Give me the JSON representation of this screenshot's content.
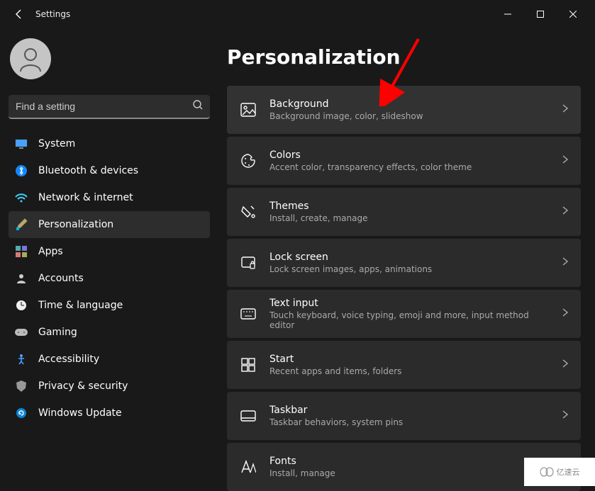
{
  "app_title": "Settings",
  "search": {
    "placeholder": "Find a setting"
  },
  "sidebar": {
    "items": [
      {
        "label": "System"
      },
      {
        "label": "Bluetooth & devices"
      },
      {
        "label": "Network & internet"
      },
      {
        "label": "Personalization"
      },
      {
        "label": "Apps"
      },
      {
        "label": "Accounts"
      },
      {
        "label": "Time & language"
      },
      {
        "label": "Gaming"
      },
      {
        "label": "Accessibility"
      },
      {
        "label": "Privacy & security"
      },
      {
        "label": "Windows Update"
      }
    ]
  },
  "page": {
    "title": "Personalization",
    "cards": [
      {
        "title": "Background",
        "sub": "Background image, color, slideshow"
      },
      {
        "title": "Colors",
        "sub": "Accent color, transparency effects, color theme"
      },
      {
        "title": "Themes",
        "sub": "Install, create, manage"
      },
      {
        "title": "Lock screen",
        "sub": "Lock screen images, apps, animations"
      },
      {
        "title": "Text input",
        "sub": "Touch keyboard, voice typing, emoji and more, input method editor"
      },
      {
        "title": "Start",
        "sub": "Recent apps and items, folders"
      },
      {
        "title": "Taskbar",
        "sub": "Taskbar behaviors, system pins"
      },
      {
        "title": "Fonts",
        "sub": "Install, manage"
      }
    ]
  },
  "watermark": "亿速云"
}
